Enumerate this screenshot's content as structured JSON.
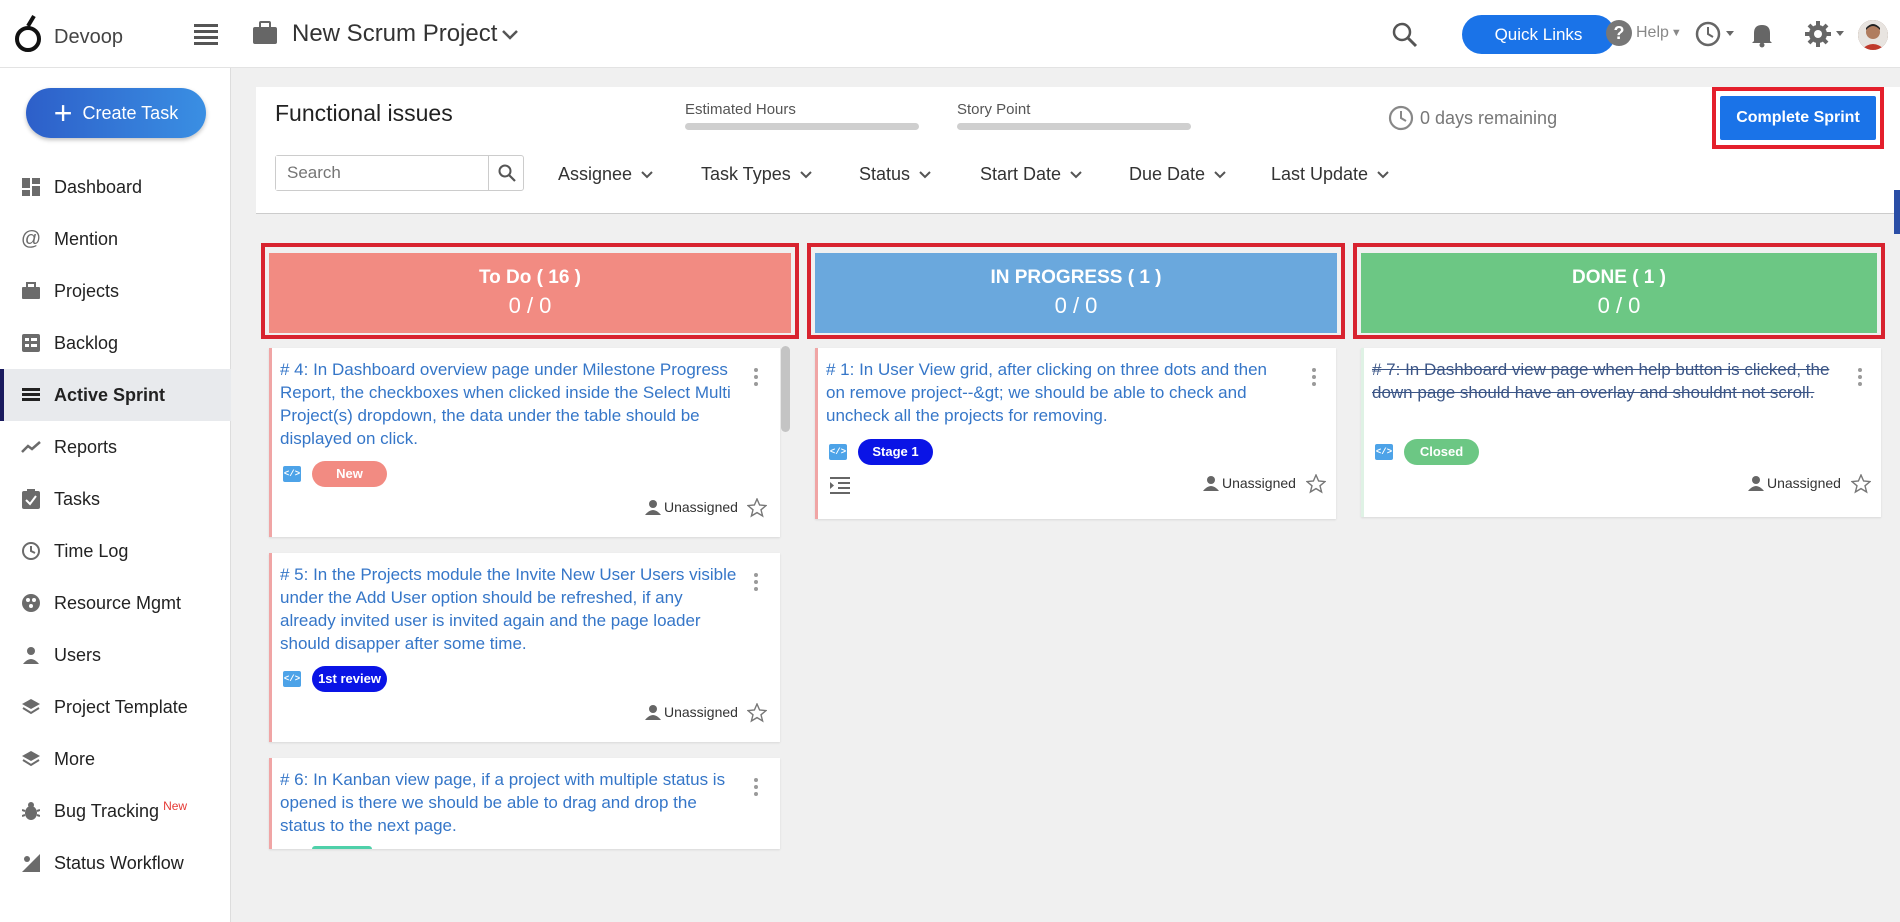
{
  "app": {
    "name": "Devoop"
  },
  "header": {
    "project_title": "New Scrum Project",
    "quick_links": "Quick Links",
    "help": "Help"
  },
  "sidebar": {
    "create_task": "Create Task",
    "items": [
      {
        "label": "Dashboard",
        "icon": "dashboard-icon"
      },
      {
        "label": "Mention",
        "icon": "at-icon"
      },
      {
        "label": "Projects",
        "icon": "briefcase-icon"
      },
      {
        "label": "Backlog",
        "icon": "backlog-icon"
      },
      {
        "label": "Active Sprint",
        "icon": "list-icon",
        "active": true
      },
      {
        "label": "Reports",
        "icon": "trend-icon"
      },
      {
        "label": "Tasks",
        "icon": "clipboard-icon"
      },
      {
        "label": "Time Log",
        "icon": "clock-icon"
      },
      {
        "label": "Resource Mgmt",
        "icon": "resource-icon"
      },
      {
        "label": "Users",
        "icon": "user-icon"
      },
      {
        "label": "Project Template",
        "icon": "layers-icon"
      },
      {
        "label": "More",
        "icon": "layers-icon"
      },
      {
        "label": "Bug Tracking",
        "icon": "bug-icon",
        "badge": "New"
      },
      {
        "label": "Status Workflow",
        "icon": "workflow-icon"
      }
    ]
  },
  "sprint": {
    "name": "Functional issues",
    "estimated_hours_label": "Estimated Hours",
    "story_point_label": "Story Point",
    "remaining": "0 days remaining",
    "complete_button": "Complete Sprint",
    "search_placeholder": "Search",
    "filters": [
      "Assignee",
      "Task Types",
      "Status",
      "Start Date",
      "Due Date",
      "Last Update"
    ]
  },
  "columns": [
    {
      "title": "To Do ( 16 )",
      "count": "0 / 0",
      "color": "#f28b82",
      "cards": [
        {
          "title": "# 4: In Dashboard overview page under Milestone Progress Report, the checkboxes when clicked inside the Select Multi Project(s) dropdown, the data under the table should be displayed on click.",
          "tag": "New",
          "tag_color": "#f28b82",
          "assignee": "Unassigned"
        },
        {
          "title": "# 5: In the Projects module the Invite New User Users visible under the Add User option should be refreshed, if any already invited user is invited again and the page loader should disapper after some time.",
          "tag": "1st review",
          "tag_color": "#0a14e6",
          "assignee": "Unassigned"
        },
        {
          "title": "# 6: In Kanban view page, if a project with multiple status is opened is there we should be able to drag and drop the status to the next page."
        }
      ]
    },
    {
      "title": "IN PROGRESS ( 1 )",
      "count": "0 / 0",
      "color": "#6aa8dd",
      "cards": [
        {
          "title": "# 1: In User View grid, after clicking on three dots and then on remove project--&gt; we should be able to check and uncheck all the projects for removing.",
          "tag": "Stage 1",
          "tag_color": "#0a14e6",
          "assignee": "Unassigned"
        }
      ]
    },
    {
      "title": "DONE ( 1 )",
      "count": "0 / 0",
      "color": "#6cc784",
      "cards": [
        {
          "title": "# 7: In Dashboard view page when help button is clicked, the down page should have an overlay and shouldnt not scroll.",
          "tag": "Closed",
          "tag_color": "#6cc784",
          "assignee": "Unassigned"
        }
      ]
    }
  ]
}
